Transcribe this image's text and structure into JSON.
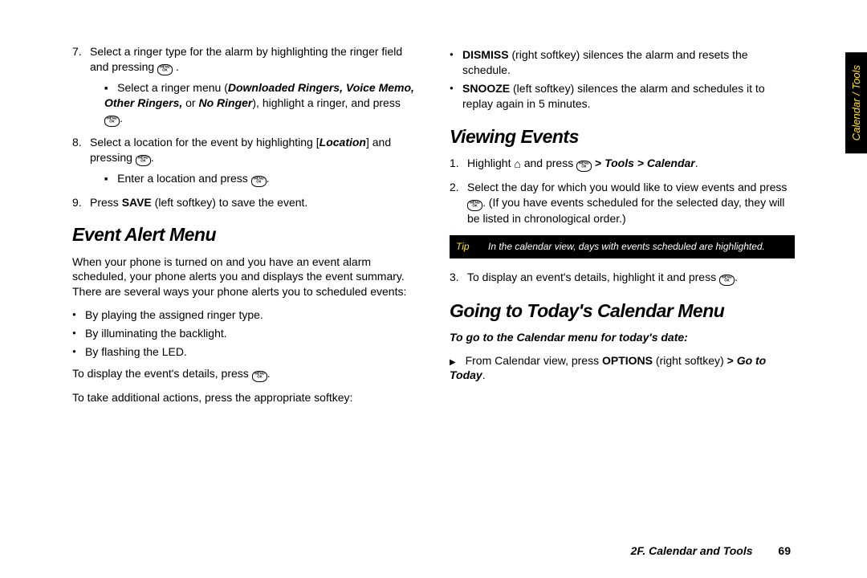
{
  "sidetab": "Calendar / Tools",
  "footer": {
    "section": "2F. Calendar and Tools",
    "page": "69"
  },
  "left": {
    "step7_a": "Select a ringer type for the alarm by highlighting the ringer field and pressing ",
    "step7_b": ".",
    "step7_sub_a": "Select a ringer menu (",
    "step7_sub_ringers": "Downloaded Ringers, Voice Memo, Other Ringers,",
    "step7_sub_or": " or ",
    "step7_sub_noringer": "No Ringer",
    "step7_sub_c": "), highlight a ringer, and press ",
    "step7_sub_d": ".",
    "step8_a": "Select a location for the event by highlighting [",
    "step8_loc": "Location",
    "step8_b": "] and pressing ",
    "step8_c": ".",
    "step8_sub_a": "Enter a location and press ",
    "step8_sub_b": ".",
    "step9_a": "Press ",
    "step9_save": "SAVE",
    "step9_b": " (left softkey) to save the event.",
    "h2_event": "Event Alert Menu",
    "event_para": "When your phone is turned on and you have an event alarm scheduled, your phone alerts you and displays the event summary. There are several ways your phone alerts you to scheduled events:",
    "bul1": "By playing the assigned ringer type.",
    "bul2": "By illuminating the backlight.",
    "bul3": "By flashing the LED.",
    "disp_a": "To display the event's details, press ",
    "disp_b": ".",
    "take_actions": "To take additional actions, press the appropriate softkey:"
  },
  "right": {
    "dismiss_a": "DISMISS",
    "dismiss_b": " (right softkey) silences the alarm and resets the schedule.",
    "snooze_a": "SNOOZE",
    "snooze_b": " (left softkey) silences the alarm and schedules it to replay again in 5 minutes.",
    "h2_view": "Viewing Events",
    "view1_a": "Highlight ",
    "view1_b": " and press ",
    "view1_path": "Tools > Calendar",
    "view1_c": ".",
    "view2_a": "Select the day for which you would like to view events and press ",
    "view2_b": ". (If you have events scheduled for the selected day, they will be listed in chronological order.)",
    "tip_label": "Tip",
    "tip_text": "In the calendar view, days with events scheduled are highlighted.",
    "view3_a": "To display an event's details, highlight it and press ",
    "view3_b": ".",
    "h2_today": "Going to Today's Calendar Menu",
    "today_lead": "To go to the Calendar menu for today's date:",
    "today_step_a": "From Calendar view, press ",
    "today_options": "OPTIONS",
    "today_step_b": " (right softkey) ",
    "today_gt": ">",
    "today_goto": "Go to Today",
    "today_step_c": "."
  }
}
